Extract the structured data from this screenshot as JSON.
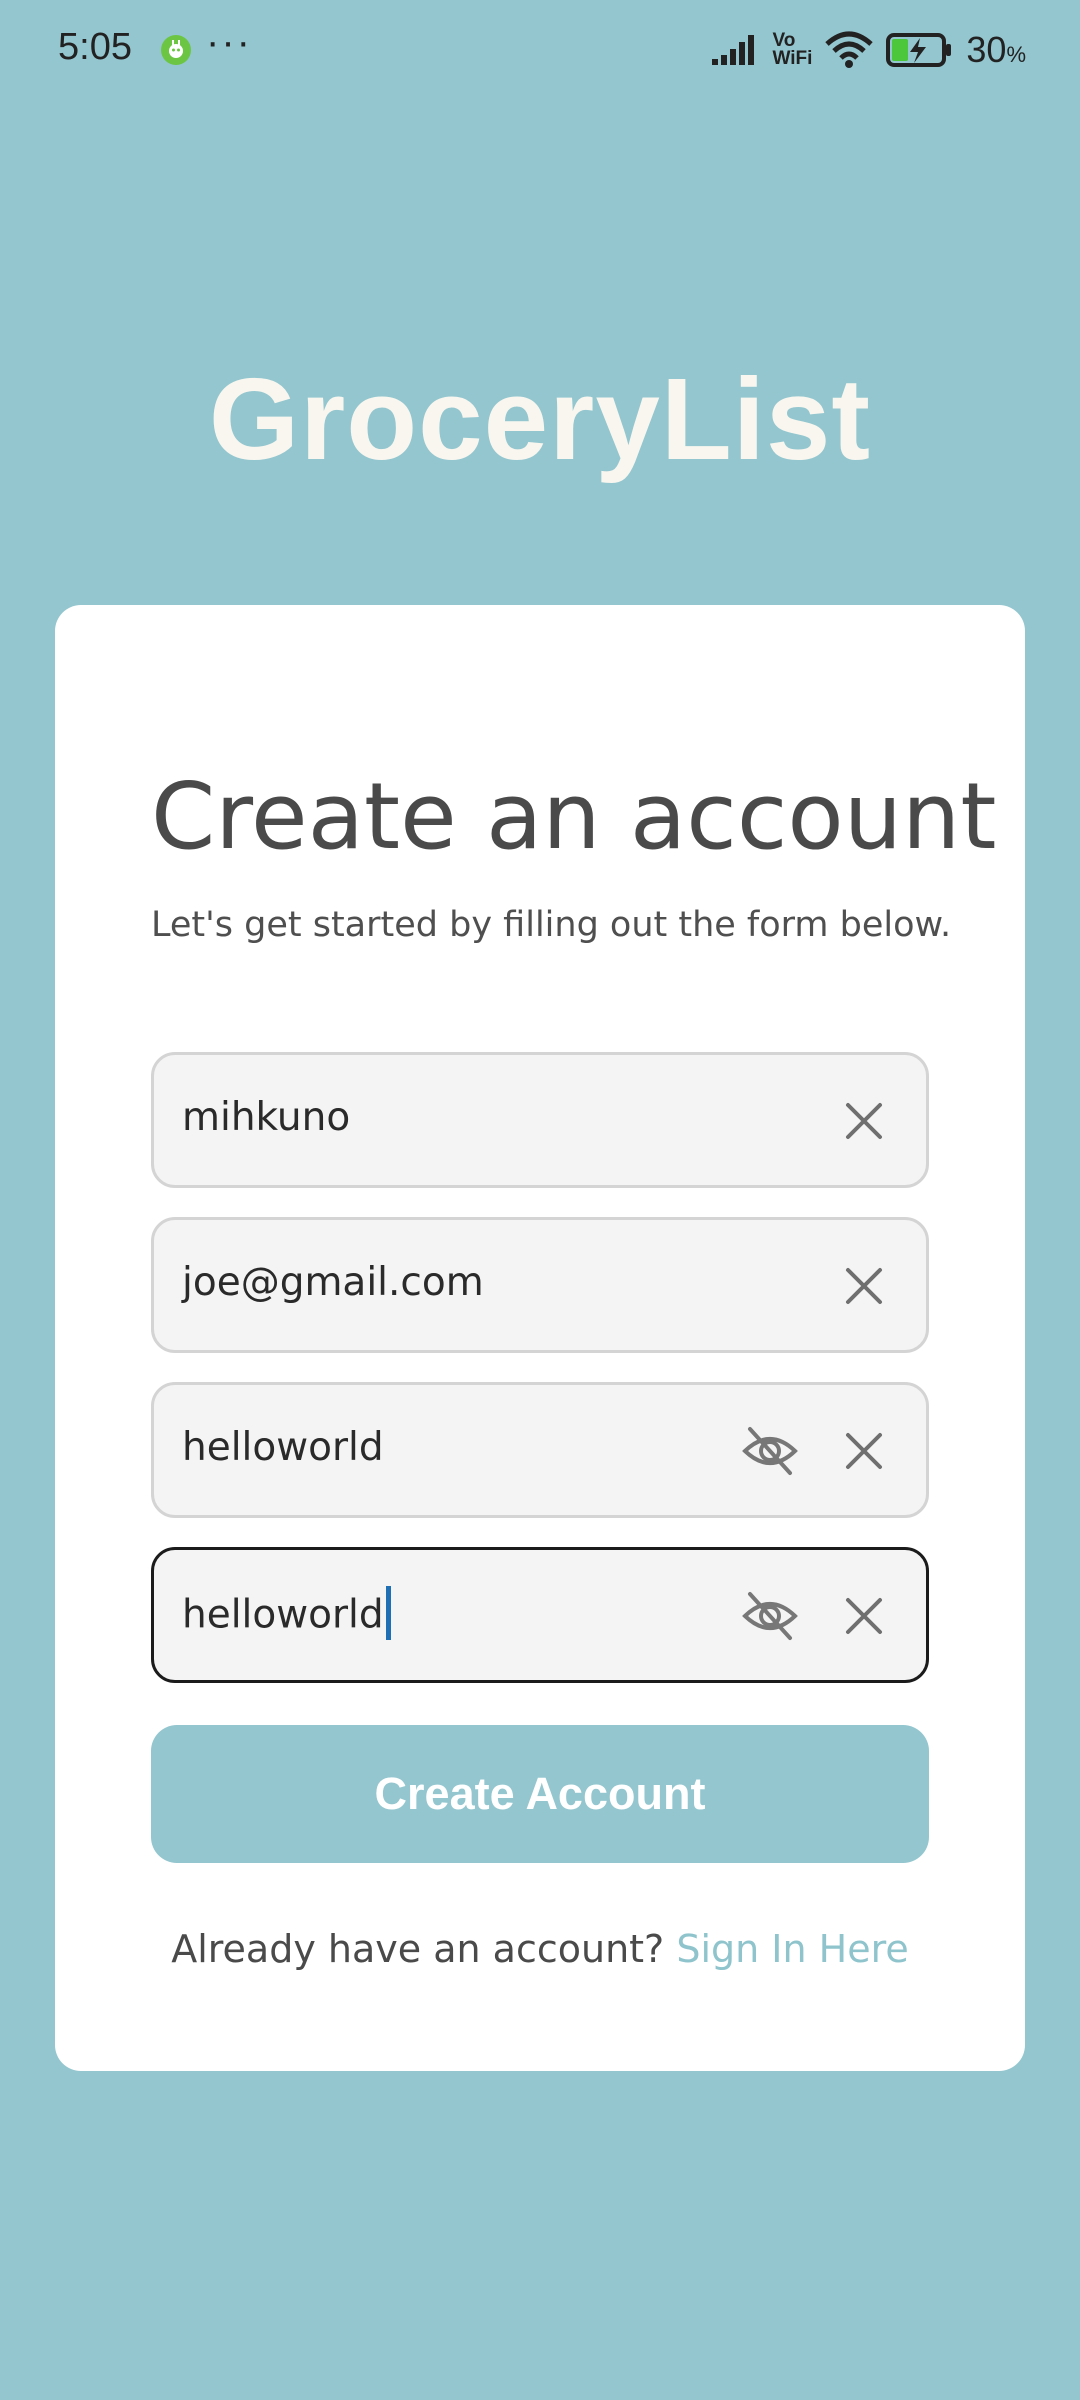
{
  "status_bar": {
    "time": "5:05",
    "more": "···",
    "vowifi_top": "Vo",
    "vowifi_bottom": "WiFi",
    "battery_percent": "30",
    "battery_unit": "%"
  },
  "app": {
    "title": "GroceryList",
    "background_color": "#93c6cf"
  },
  "form": {
    "title": "Create an account",
    "subtitle": "Let's get started by filling out the form below.",
    "fields": [
      {
        "name": "username",
        "value": "mihkuno",
        "icons": [
          "close-icon"
        ]
      },
      {
        "name": "email",
        "value": "joe@gmail.com",
        "icons": [
          "close-icon"
        ]
      },
      {
        "name": "password",
        "value": "helloworld",
        "icons": [
          "eye-off-icon",
          "close-icon"
        ]
      },
      {
        "name": "confirm-password",
        "value": "helloworld",
        "icons": [
          "eye-off-icon",
          "close-icon"
        ],
        "focused": true
      }
    ],
    "submit_label": "Create Account",
    "signin_prompt": "Already have an account?",
    "signin_link": "Sign In Here"
  }
}
